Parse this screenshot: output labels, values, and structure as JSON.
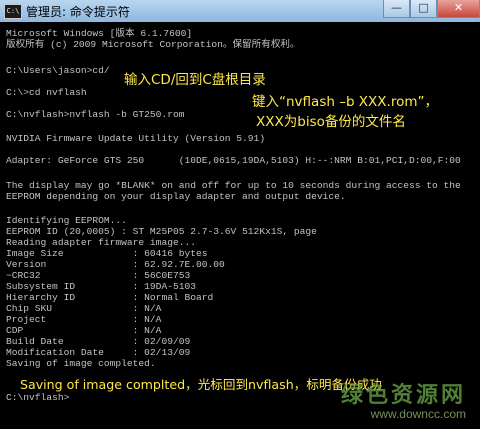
{
  "window": {
    "icon_label": "C:\\",
    "title": "管理员: 命令提示符",
    "controls": {
      "minimize": "—",
      "maximize": "□",
      "close": "✕"
    }
  },
  "console": {
    "lines": [
      "Microsoft Windows [版本 6.1.7600]",
      "版权所有 (c) 2009 Microsoft Corporation。保留所有权利。",
      "",
      "C:\\Users\\jason>cd/",
      "",
      "C:\\>cd nvflash",
      "",
      "C:\\nvflash>nvflash -b GT250.rom",
      "",
      "NVIDIA Firmware Update Utility (Version 5.91)",
      "",
      "Adapter: GeForce GTS 250      (10DE,0615,19DA,5103) H:--:NRM B:01,PCI,D:00,F:00",
      "",
      "The display may go *BLANK* on and off for up to 10 seconds during access to the",
      "EEPROM depending on your display adapter and output device.",
      "",
      "Identifying EEPROM...",
      "EEPROM ID (20,0005) : ST M25P05 2.7-3.6V 512Kx1S, page",
      "Reading adapter firmware image...",
      "Image Size            : 60416 bytes",
      "Version               : 62.92.7E.00.00",
      "~CRC32                : 56C0E753",
      "Subsystem ID          : 19DA-5103",
      "Hierarchy ID          : Normal Board",
      "Chip SKU              : N/A",
      "Project               : N/A",
      "CDP                   : N/A",
      "Build Date            : 02/09/09",
      "Modification Date     : 02/13/09",
      "Saving of image completed.",
      "",
      "C:\\nvflash>"
    ]
  },
  "annotations": [
    "输入CD/回到C盘根目录",
    "键入“nvflash –b XXX.rom”，",
    "XXX为biso备份的文件名",
    "Saving of image complted，光标回到nvflash，标明备份成功"
  ],
  "watermark": {
    "title": "绿色资源网",
    "url": "www.downcc.com"
  }
}
